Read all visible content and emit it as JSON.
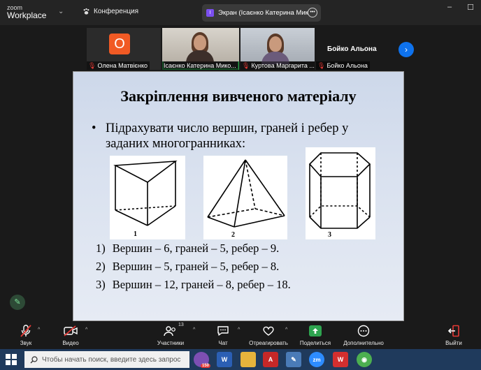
{
  "app": {
    "logo_line1": "zoom",
    "logo_line2": "Workplace"
  },
  "meeting": {
    "label": "Конференция"
  },
  "screen_tab": {
    "icon_letter": "I",
    "title": "Экран (Ісаєнко Катерина Микол"
  },
  "participants": [
    {
      "name": "Олена Матвієнко",
      "avatar_letter": "О",
      "muted": true
    },
    {
      "name": "Ісаєнко Катерина Мико...",
      "muted": false,
      "active": true
    },
    {
      "name": "Куртова Маргарита ...",
      "muted": true
    },
    {
      "name": "Бойко Альона",
      "muted": true
    }
  ],
  "featured_name": "Бойко Альона",
  "slide": {
    "title": "Закріплення вивченого матеріалу",
    "bullet_marker": "•",
    "bullet": "Підрахувати число вершин, граней і ребер у заданих многогранниках:",
    "figure_labels": [
      "1",
      "2",
      "3"
    ],
    "answer_numbers": [
      "1)",
      "2)",
      "3)"
    ],
    "answers": [
      "Вершин – 6, граней – 5, ребер – 9.",
      "Вершин – 5, граней – 5, ребер – 8.",
      "Вершин – 12, граней – 8, ребер – 18."
    ]
  },
  "toolbar": {
    "audio": "Звук",
    "video": "Видео",
    "participants": "Участники",
    "participants_count": "13",
    "chat": "Чат",
    "react": "Отреагировать",
    "share": "Поделиться",
    "more": "Дополнительно",
    "leave": "Выйти"
  },
  "taskbar": {
    "search_placeholder": "Чтобы начать поиск, введите здесь запрос",
    "viber_badge": "150"
  },
  "colors": {
    "accent_blue": "#0e72ed",
    "share_green": "#2ea44f",
    "leave_red": "#e53935",
    "avatar_orange": "#f15a24"
  }
}
